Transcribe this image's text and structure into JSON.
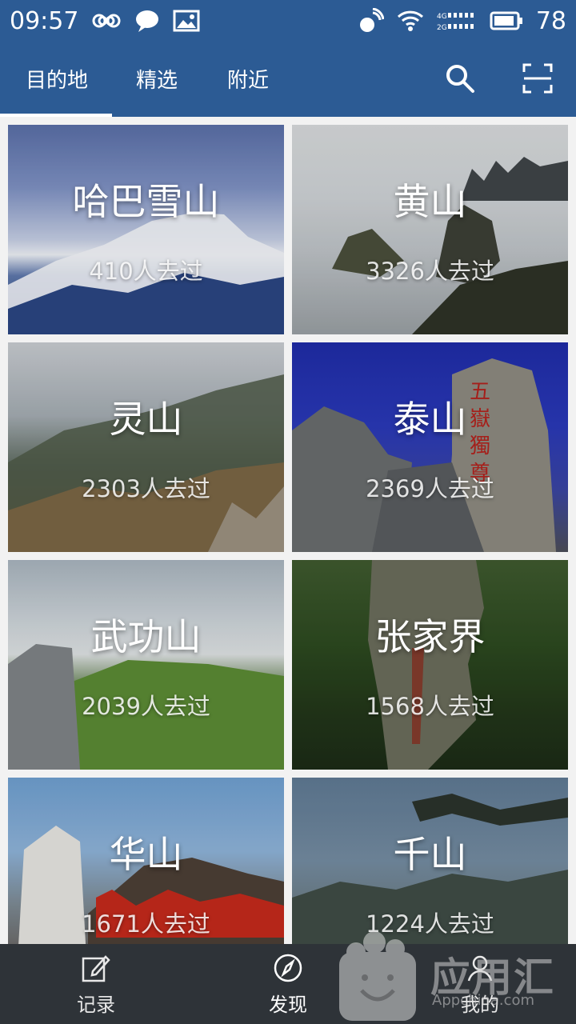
{
  "status_bar": {
    "time": "09:57",
    "battery_percent": "78"
  },
  "tabs": [
    {
      "label": "目的地",
      "active": true
    },
    {
      "label": "精选",
      "active": false
    },
    {
      "label": "附近",
      "active": false
    }
  ],
  "actions": {
    "search_icon": "search-icon",
    "scan_icon": "scan-icon"
  },
  "destinations": [
    {
      "name": "哈巴雪山",
      "count": "410人去过"
    },
    {
      "name": "黄山",
      "count": "3326人去过"
    },
    {
      "name": "灵山",
      "count": "2303人去过"
    },
    {
      "name": "泰山",
      "count": "2369人去过"
    },
    {
      "name": "武功山",
      "count": "2039人去过"
    },
    {
      "name": "张家界",
      "count": "1568人去过"
    },
    {
      "name": "华山",
      "count": "1671人去过"
    },
    {
      "name": "千山",
      "count": "1224人去过"
    }
  ],
  "bottom_nav": [
    {
      "label": "记录",
      "icon": "edit-icon"
    },
    {
      "label": "发现",
      "icon": "compass-icon",
      "active": true
    },
    {
      "label": "我的",
      "icon": "profile-icon"
    }
  ],
  "watermark": {
    "text": "应用汇",
    "sub": "Appchina.com"
  },
  "colors": {
    "primary": "#2c5b94",
    "bottom_nav": "#2e3338"
  }
}
